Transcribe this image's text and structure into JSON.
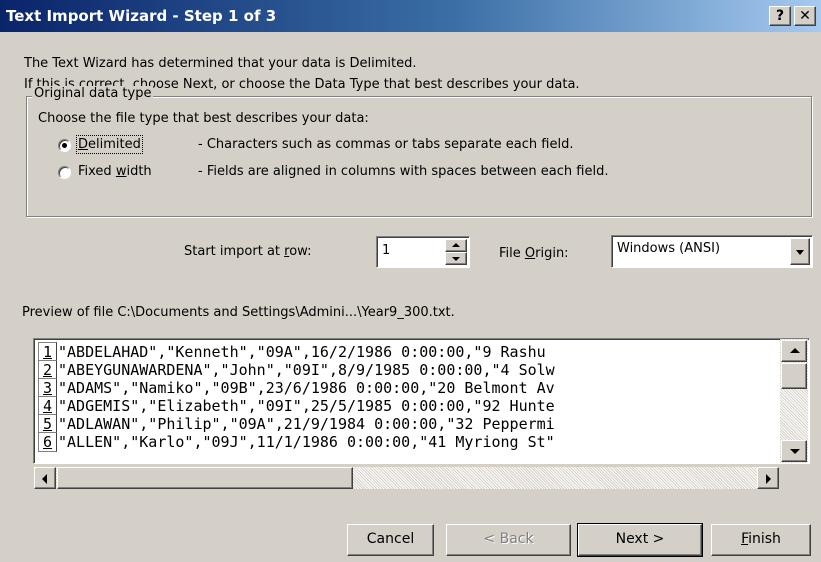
{
  "window": {
    "title": "Text Import Wizard - Step 1 of 3",
    "help_glyph": "?",
    "close_glyph": "✕"
  },
  "intro": {
    "line1": "The Text Wizard has determined that your data is Delimited.",
    "line2": "If this is correct, choose Next, or choose the Data Type that best describes your data."
  },
  "data_type": {
    "group_label": "Original data type",
    "prompt": "Choose the file type that best describes your data:",
    "options": [
      {
        "label_before": "",
        "accel": "D",
        "label_after": "elimited",
        "description": "- Characters such as commas or tabs separate each field.",
        "selected": true
      },
      {
        "label_before": "Fixed ",
        "accel": "w",
        "label_after": "idth",
        "description": "- Fields are aligned in columns with spaces between each field.",
        "selected": false
      }
    ]
  },
  "start_row": {
    "label_before": "Start import at ",
    "accel": "r",
    "label_after": "ow:",
    "value": "1"
  },
  "file_origin": {
    "label_before": "File ",
    "accel": "O",
    "label_after": "rigin:",
    "value": "Windows (ANSI)"
  },
  "preview": {
    "label": "Preview of file C:\\Documents and Settings\\Admini...\\Year9_300.txt.",
    "lines": [
      {
        "num": "1",
        "text": "\"ABDELAHAD\",\"Kenneth\",\"09A\",16/2/1986 0:00:00,\"9 Rashu"
      },
      {
        "num": "2",
        "text": "\"ABEYGUNAWARDENA\",\"John\",\"09I\",8/9/1985 0:00:00,\"4 Solw"
      },
      {
        "num": "3",
        "text": "\"ADAMS\",\"Namiko\",\"09B\",23/6/1986 0:00:00,\"20 Belmont Av"
      },
      {
        "num": "4",
        "text": "\"ADGEMIS\",\"Elizabeth\",\"09I\",25/5/1985 0:00:00,\"92 Hunte"
      },
      {
        "num": "5",
        "text": "\"ADLAWAN\",\"Philip\",\"09A\",21/9/1984 0:00:00,\"32 Peppermi"
      },
      {
        "num": "6",
        "text": "\"ALLEN\",\"Karlo\",\"09J\",11/1/1986 0:00:00,\"41 Myriong St\""
      }
    ]
  },
  "buttons": {
    "cancel": "Cancel",
    "back": "< Back",
    "next": "Next >",
    "finish_accel": "F",
    "finish_rest": "inish"
  }
}
